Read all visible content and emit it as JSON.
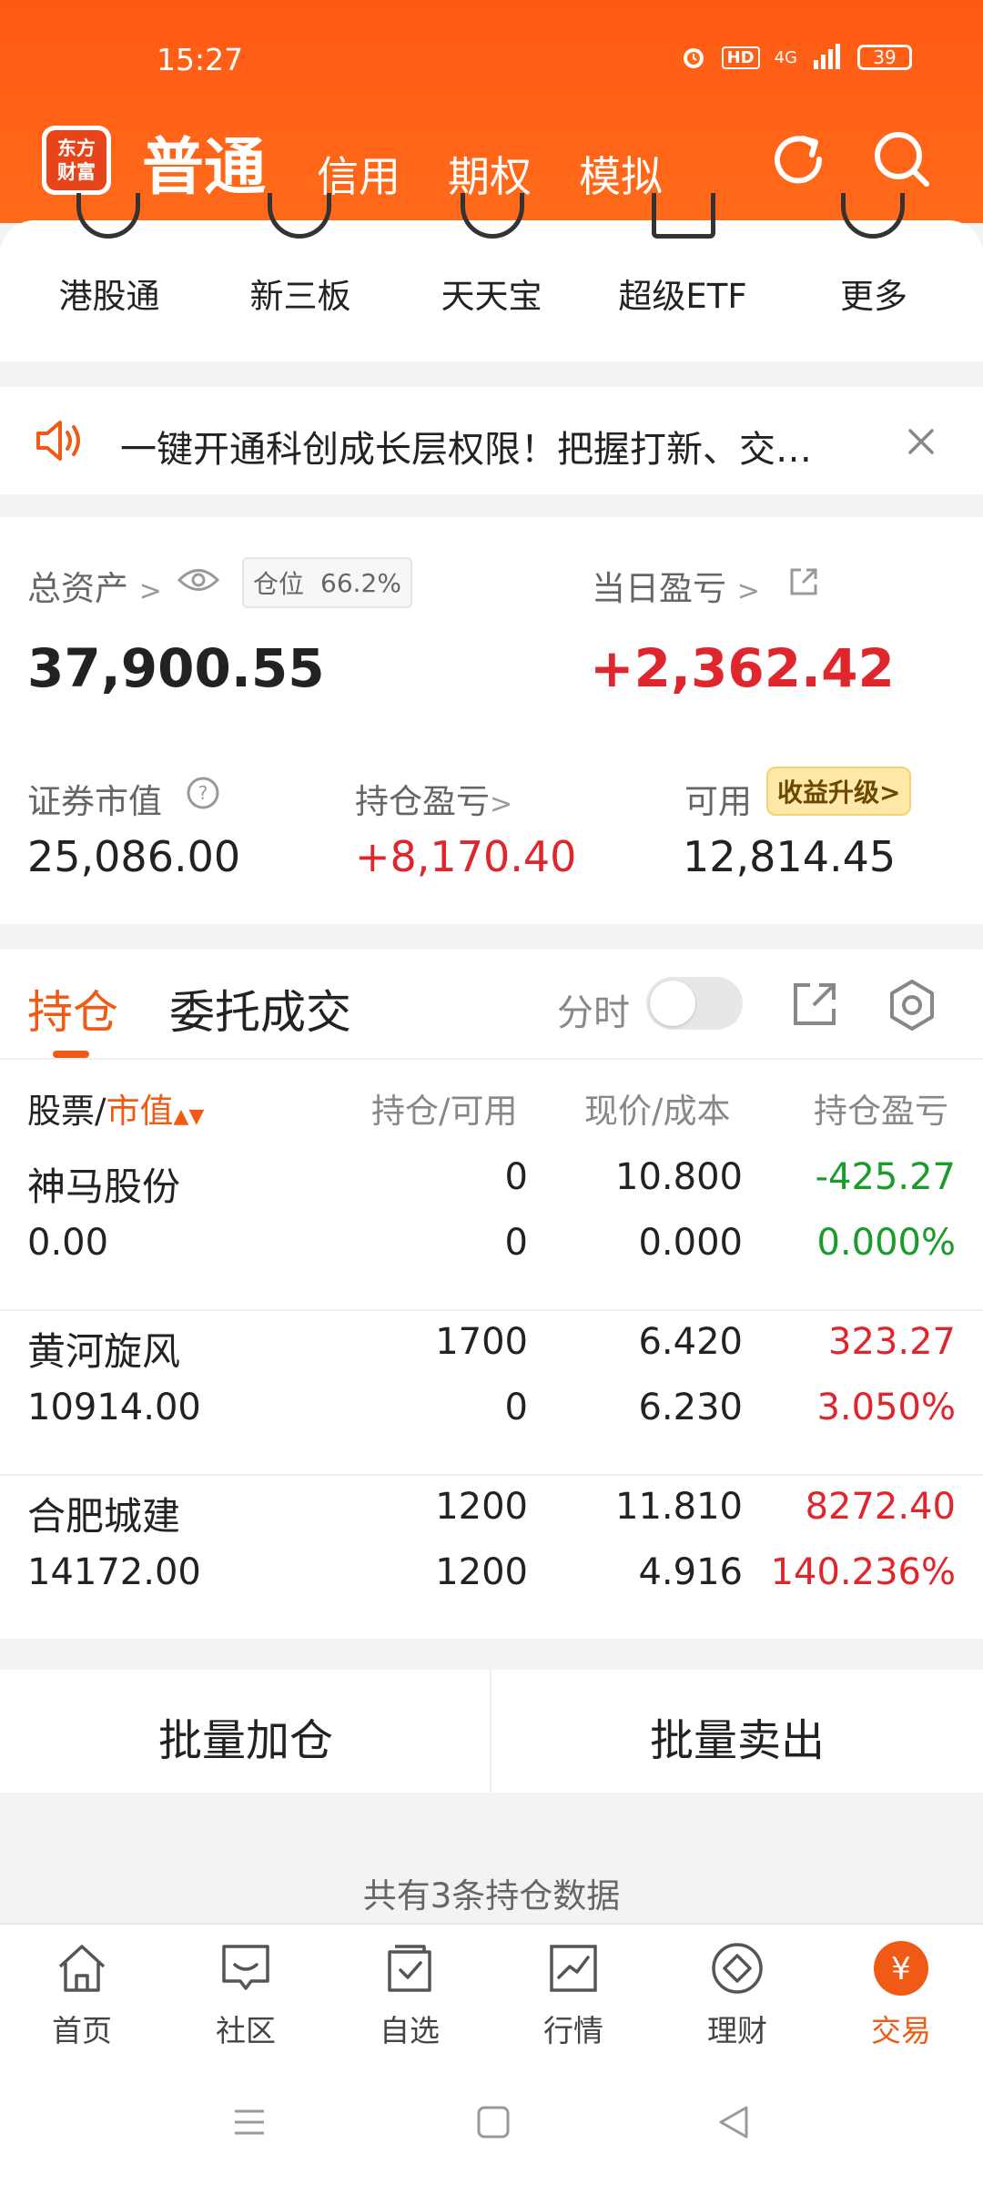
{
  "status": {
    "time": "15:27",
    "hd": "HD",
    "network": "4G",
    "battery": "39"
  },
  "header": {
    "logo_line1": "东方",
    "logo_line2": "财富",
    "tabs": [
      "普通",
      "信用",
      "期权",
      "模拟"
    ],
    "refresh_icon": "refresh-icon",
    "search_icon": "search-icon"
  },
  "shortcuts": [
    "港股通",
    "新三板",
    "天天宝",
    "超级ETF",
    "更多"
  ],
  "notice": {
    "text": "一键开通科创成长层权限！把握打新、交…",
    "icon": "speaker-icon",
    "close_icon": "close-icon"
  },
  "assets": {
    "total_label": "总资产",
    "position_label": "仓位",
    "position_value": "66.2%",
    "total_value": "37,900.55",
    "daily_pl_label": "当日盈亏",
    "daily_pl_value": "+2,362.42",
    "market_value_label": "证券市值",
    "market_value": "25,086.00",
    "hold_pl_label": "持仓盈亏",
    "hold_pl_value": "+8,170.40",
    "available_label": "可用",
    "available_value": "12,814.45",
    "upgrade_badge": "收益升级>"
  },
  "holdings": {
    "tabs": [
      "持仓",
      "委托成交"
    ],
    "timeshare_label": "分时",
    "columns": {
      "stock_prefix": "股票/",
      "stock_sort": "市值",
      "qty": "持仓/可用",
      "price": "现价/成本",
      "pl": "持仓盈亏"
    },
    "rows": [
      {
        "name": "神马股份",
        "mv": "0.00",
        "hold": "0",
        "avail": "0",
        "price": "10.800",
        "cost": "0.000",
        "pl": "-425.27",
        "plpct": "0.000%",
        "color": "#1a9b2a"
      },
      {
        "name": "黄河旋风",
        "mv": "10914.00",
        "hold": "1700",
        "avail": "0",
        "price": "6.420",
        "cost": "6.230",
        "pl": "323.27",
        "plpct": "3.050%",
        "color": "#e0262d"
      },
      {
        "name": "合肥城建",
        "mv": "14172.00",
        "hold": "1200",
        "avail": "1200",
        "price": "11.810",
        "cost": "4.916",
        "pl": "8272.40",
        "plpct": "140.236%",
        "color": "#e0262d"
      }
    ]
  },
  "actions": {
    "add": "批量加仓",
    "sell": "批量卖出"
  },
  "footer_note": "共有3条持仓数据",
  "nav": {
    "items": [
      {
        "label": "首页",
        "icon": "home-icon"
      },
      {
        "label": "社区",
        "icon": "community-icon"
      },
      {
        "label": "自选",
        "icon": "watchlist-icon"
      },
      {
        "label": "行情",
        "icon": "market-icon"
      },
      {
        "label": "理财",
        "icon": "wealth-icon"
      },
      {
        "label": "交易",
        "icon": "trade-icon"
      }
    ],
    "active_color": "#f05a14"
  }
}
